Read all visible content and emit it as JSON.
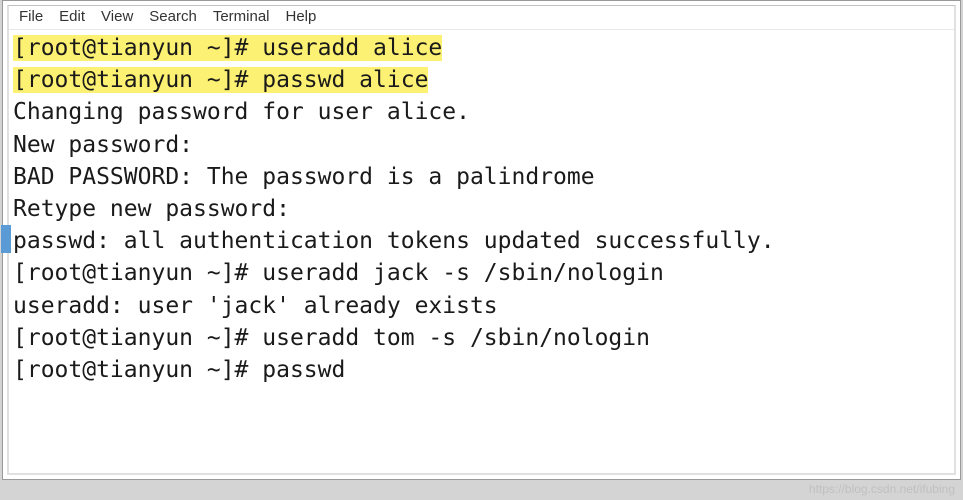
{
  "menu": {
    "file": "File",
    "edit": "Edit",
    "view": "View",
    "search": "Search",
    "terminal": "Terminal",
    "help": "Help"
  },
  "terminal": {
    "line1": "[root@tianyun ~]# useradd alice",
    "line2": "[root@tianyun ~]# passwd alice",
    "line3": "Changing password for user alice.",
    "line4": "New password:",
    "line5": "BAD PASSWORD: The password is a palindrome",
    "line6": "Retype new password:",
    "line7": "passwd: all authentication tokens updated successfully.",
    "line8": "[root@tianyun ~]# useradd jack -s /sbin/nologin",
    "line9": "useradd: user 'jack' already exists",
    "line10": "[root@tianyun ~]# useradd tom -s /sbin/nologin",
    "line11": "[root@tianyun ~]# passwd"
  },
  "watermark": "https://blog.csdn.net/ifubing"
}
